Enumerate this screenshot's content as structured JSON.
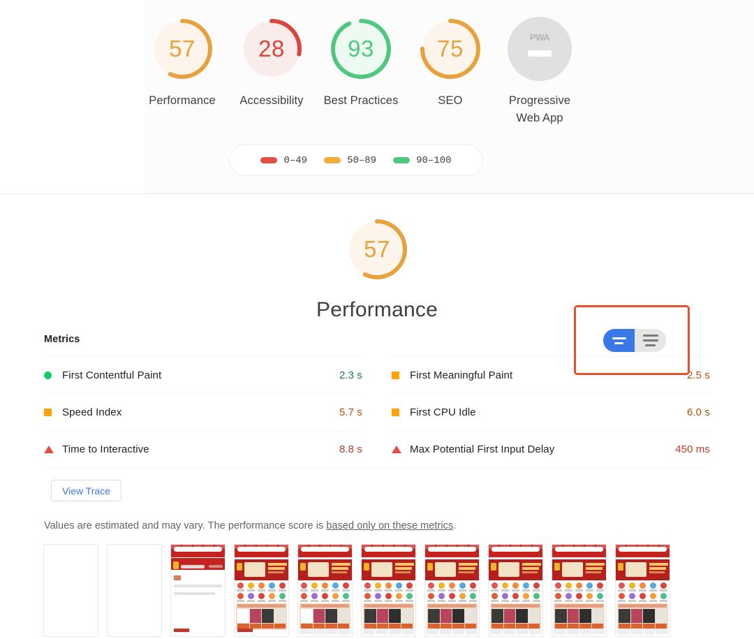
{
  "report": {
    "scores": [
      {
        "id": "performance",
        "value": "57",
        "label": "Performance",
        "band": "average",
        "color": "#e7a13d",
        "bg": "#fdf5eb",
        "pct": 57
      },
      {
        "id": "accessibility",
        "value": "28",
        "label": "Accessibility",
        "band": "fail",
        "color": "#d8463c",
        "bg": "#fbecec",
        "pct": 28
      },
      {
        "id": "best-practices",
        "value": "93",
        "label": "Best Practices",
        "band": "pass",
        "color": "#4ec77f",
        "bg": "#edfaf2",
        "pct": 93
      },
      {
        "id": "seo",
        "value": "75",
        "label": "SEO",
        "band": "average",
        "color": "#e7a13d",
        "bg": "#fdf5eb",
        "pct": 75
      },
      {
        "id": "pwa",
        "value": "PWA",
        "label": "Progressive Web App",
        "band": "none",
        "color": "#b5b5b5",
        "bg": "#e0e0e0",
        "pct": 0
      }
    ],
    "legend": {
      "items": [
        {
          "range": "0–49",
          "color": "#e34f41"
        },
        {
          "range": "50–89",
          "color": "#f0ad3c"
        },
        {
          "range": "90–100",
          "color": "#4ec77f"
        }
      ]
    },
    "category": {
      "score": "57",
      "title": "Performance",
      "color": "#e7a13d",
      "bg": "#fdf5eb",
      "pct": 57
    },
    "metrics": {
      "heading": "Metrics",
      "toggle": {
        "name": "metric-description-toggle",
        "options": [
          "compact-view",
          "expanded-view"
        ],
        "selected": "compact-view",
        "active_color": "#3b78e7",
        "inactive_color": "#e6e6e6"
      },
      "left_column": [
        {
          "name": "First Contentful Paint",
          "value": "2.3 s",
          "status": "pass",
          "indicator": "dot-green"
        },
        {
          "name": "Speed Index",
          "value": "5.7 s",
          "status": "average",
          "indicator": "sq-orange"
        },
        {
          "name": "Time to Interactive",
          "value": "8.8 s",
          "status": "fail",
          "indicator": "tri-red"
        }
      ],
      "right_column": [
        {
          "name": "First Meaningful Paint",
          "value": "2.5 s",
          "status": "average",
          "indicator": "sq-orange"
        },
        {
          "name": "First CPU Idle",
          "value": "6.0 s",
          "status": "average",
          "indicator": "sq-orange"
        },
        {
          "name": "Max Potential First Input Delay",
          "value": "450 ms",
          "status": "fail",
          "indicator": "tri-red"
        }
      ],
      "view_trace_label": "View Trace",
      "disclaimer_prefix": "Values are estimated and may vary. The performance score is ",
      "disclaimer_link": "based only on these metrics",
      "disclaimer_suffix": "."
    },
    "filmstrip": {
      "frames": [
        {
          "state": "blank"
        },
        {
          "state": "blank"
        },
        {
          "state": "partial"
        },
        {
          "state": "loaded"
        },
        {
          "state": "loaded"
        },
        {
          "state": "loaded"
        },
        {
          "state": "loaded"
        },
        {
          "state": "loaded"
        },
        {
          "state": "loaded"
        },
        {
          "state": "loaded"
        }
      ]
    }
  }
}
